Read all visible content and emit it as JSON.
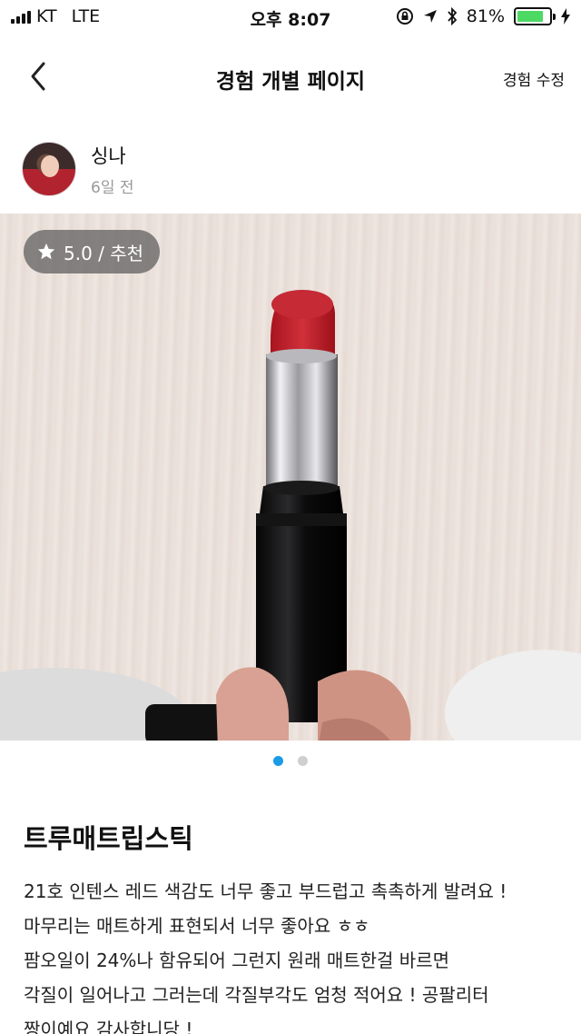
{
  "status_bar": {
    "carrier": "KT",
    "network": "LTE",
    "time": "오후 8:07",
    "battery_percent": "81%",
    "battery_level": 0.81,
    "icons": [
      "signal-icon",
      "rotation-lock-icon",
      "location-icon",
      "bluetooth-icon",
      "battery-icon",
      "charging-icon"
    ]
  },
  "nav": {
    "back_icon": "chevron-left-icon",
    "title": "경험 개별 페이지",
    "edit_label": "경험 수정"
  },
  "author": {
    "name": "싱나",
    "time_ago": "6일 전"
  },
  "photo": {
    "rating_badge": "5.0 / 추천",
    "icon": "star-icon",
    "page_count": 2,
    "current_page": 1
  },
  "post": {
    "title": "트루매트립스틱",
    "body_lines": [
      "21호 인텐스 레드 색감도 너무 좋고 부드럽고 촉촉하게 발려요 !",
      "마무리는 매트하게 표현되서 너무 좋아요 ㅎㅎ",
      "팜오일이 24%나 함유되어 그런지 원래 매트한걸 바르면",
      "각질이 일어나고 그러는데 각질부각도 엄청 적어요 ! 공팔리터",
      "짱이예요 감사합니당 !"
    ]
  },
  "colors": {
    "accent": "#1a9be6",
    "battery": "#4cd964",
    "lipstick": "#c8232d"
  }
}
